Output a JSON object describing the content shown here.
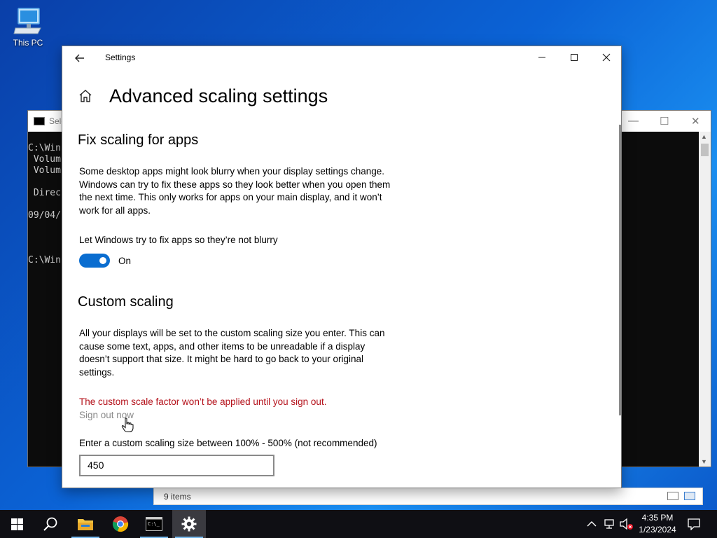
{
  "desktop": {
    "icons": [
      {
        "label": "This PC",
        "icon": "computer-icon"
      }
    ]
  },
  "explorer": {
    "status": "9 items"
  },
  "cmd": {
    "title": "Sele",
    "lines": [
      "C:\\Win",
      " Volum",
      " Volum",
      "",
      " Direc",
      "",
      "09/04/",
      "",
      "",
      "",
      "C:\\Win"
    ]
  },
  "settings": {
    "app_title": "Settings",
    "page_title": "Advanced scaling settings",
    "fix_section": {
      "heading": "Fix scaling for apps",
      "description": "Some desktop apps might look blurry when your display settings change. Windows can try to fix these apps so they look better when you open them the next time. This only works for apps on your main display, and it won’t work for all apps.",
      "toggle_label": "Let Windows try to fix apps so they’re not blurry",
      "toggle_state": "On",
      "toggle_on": true
    },
    "custom_section": {
      "heading": "Custom scaling",
      "description": "All your displays will be set to the custom scaling size you enter. This can cause some text, apps, and other items to be unreadable if a display doesn’t support that size. It might be hard to go back to your original settings.",
      "warning": "The custom scale factor won’t be applied until you sign out.",
      "sign_out_link": "Sign out now",
      "input_label": "Enter a custom scaling size between 100% - 500% (not recommended)",
      "input_value": "450"
    }
  },
  "taskbar": {
    "apps": [
      "start-icon",
      "search-icon",
      "file-explorer-icon",
      "chrome-icon",
      "command-prompt-icon",
      "settings-icon"
    ],
    "active_app": "settings-icon",
    "time": "4:35 PM",
    "date": "1/23/2024"
  },
  "colors": {
    "accent": "#0a6dd0",
    "warning": "#b4101a",
    "taskbar": "#0f0f14"
  }
}
